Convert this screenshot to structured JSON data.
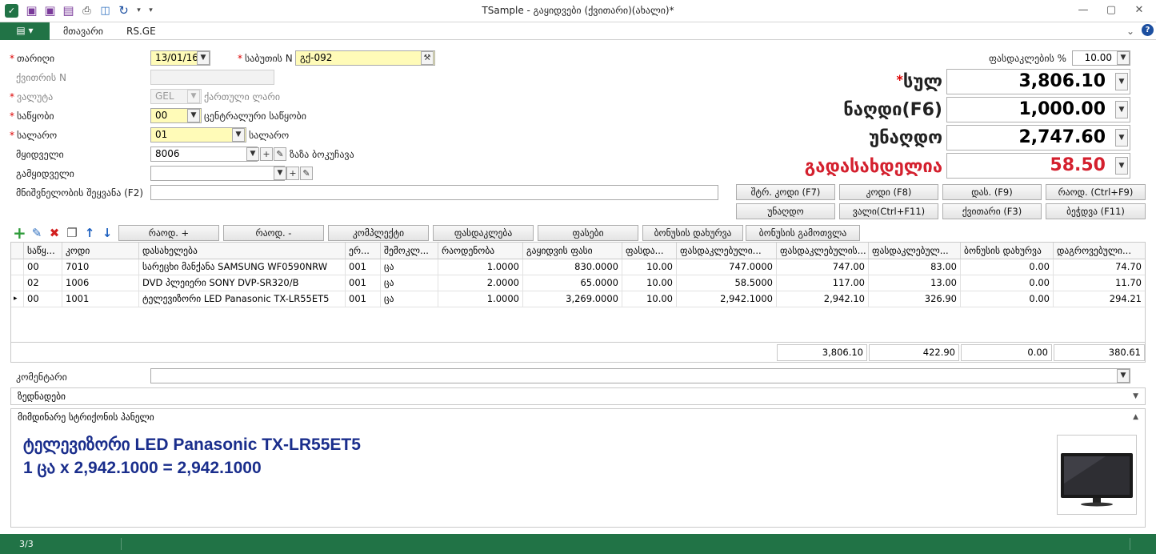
{
  "window": {
    "title": "TSample - გაყიდვები (ქვითარი)(ახალი)*",
    "minimize": "—",
    "maximize": "▢",
    "close": "✕"
  },
  "quick_access": [
    "app-logo-icon",
    "save-icon",
    "save-close-icon",
    "save-as-icon",
    "print-icon",
    "preview-icon",
    "refresh-icon",
    "dropdown-arrow-icon",
    "customize-icon"
  ],
  "menu": {
    "app_button": "▤ ▾",
    "items": [
      "მთავარი",
      "RS.GE"
    ],
    "collapse": "⌄",
    "help": "?"
  },
  "form": {
    "date_label": "თარიღი",
    "date_value": "13/01/16",
    "doc_no_label": "საბუთის N",
    "doc_no_value": "გქ-092",
    "receipt_no_label": "ქვითრის N",
    "receipt_no_value": "",
    "currency_label": "ვალუტა",
    "currency_value": "GEL",
    "currency_name": "ქართული ლარი",
    "warehouse_label": "საწყობი",
    "warehouse_value": "00",
    "warehouse_name": "ცენტრალური საწყობი",
    "cashdesk_label": "სალარო",
    "cashdesk_value": "01",
    "cashdesk_name": "სალარო",
    "buyer_label": "მყიდველი",
    "buyer_value": "8006",
    "buyer_name": "ზაზა ბოკუჩავა",
    "seller_label": "გამყიდველი",
    "seller_value": "",
    "notes_label": "მნიშვნელობის შეყვანა (F2)",
    "notes_value": "",
    "discount_label": "ფასდაკლების %",
    "discount_value": "10.00"
  },
  "totals": {
    "total_label": "სულ",
    "total_value": "3,806.10",
    "cash_label": "ნაღდი(F6)",
    "cash_value": "1,000.00",
    "noncash_label": "უნაღდო",
    "noncash_value": "2,747.60",
    "due_label": "გადასახდელია",
    "due_value": "58.50",
    "due_color": "#d4202e"
  },
  "fn_buttons": [
    "შტრ. კოდი (F7)",
    "კოდი (F8)",
    "დას. (F9)",
    "რაოდ. (Ctrl+F9)",
    "უნაღდო",
    "ვალი(Ctrl+F11)",
    "ქვითარი (F3)",
    "ბეჭდვა (F11)"
  ],
  "toolbar": {
    "icons": [
      "add-icon",
      "edit-icon",
      "delete-icon",
      "copy-icon",
      "move-up-icon",
      "move-down-icon"
    ],
    "buttons": [
      "რაოდ. +",
      "რაოდ. -",
      "კომპლექტი",
      "ფასდაკლება",
      "ფასები",
      "ბონუსის დახურვა",
      "ბონუსის გამოთვლა"
    ]
  },
  "grid": {
    "headers": [
      "საწყ...",
      "კოდი",
      "დასახელება",
      "ერ...",
      "შემოკლ...",
      "რაოდენობა",
      "გაყიდვის ფასი",
      "ფასდა...",
      "ფასდაკლებული...",
      "ფასდაკლებულის...",
      "ფასდაკლებულ...",
      "ბონუსის დახურვა",
      "დაგროვებული..."
    ],
    "rows": [
      [
        "00",
        "7010",
        "სარეცხი მანქანა SAMSUNG WF0590NRW",
        "001",
        "ცა",
        "1.0000",
        "830.0000",
        "10.00",
        "747.0000",
        "747.00",
        "83.00",
        "0.00",
        "74.70"
      ],
      [
        "02",
        "1006",
        "DVD პლეიერი SONY DVP-SR320/B",
        "001",
        "ცა",
        "2.0000",
        "65.0000",
        "10.00",
        "58.5000",
        "117.00",
        "13.00",
        "0.00",
        "11.70"
      ],
      [
        "00",
        "1001",
        "ტელევიზორი LED Panasonic TX-LR55ET5",
        "001",
        "ცა",
        "1.0000",
        "3,269.0000",
        "10.00",
        "2,942.1000",
        "2,942.10",
        "326.90",
        "0.00",
        "294.21"
      ]
    ],
    "current_row_marker": "▸",
    "sums": [
      "3,806.10",
      "422.90",
      "0.00",
      "380.61"
    ]
  },
  "comment": {
    "label": "კომენტარი",
    "value": ""
  },
  "panels": {
    "extras": "ზედნადები",
    "current_line": "მიმდინარე სტრიქონის პანელი",
    "extras_arrow": "▼",
    "current_arrow": "▲"
  },
  "current_line_info": {
    "line1": "ტელევიზორი LED Panasonic TX-LR55ET5",
    "line2": "1 ცა x 2,942.1000 = 2,942.1000"
  },
  "status": {
    "record": "3/3"
  },
  "colors": {
    "accent": "#217346",
    "required": "#dd0000",
    "info_text": "#1a2e8c"
  }
}
